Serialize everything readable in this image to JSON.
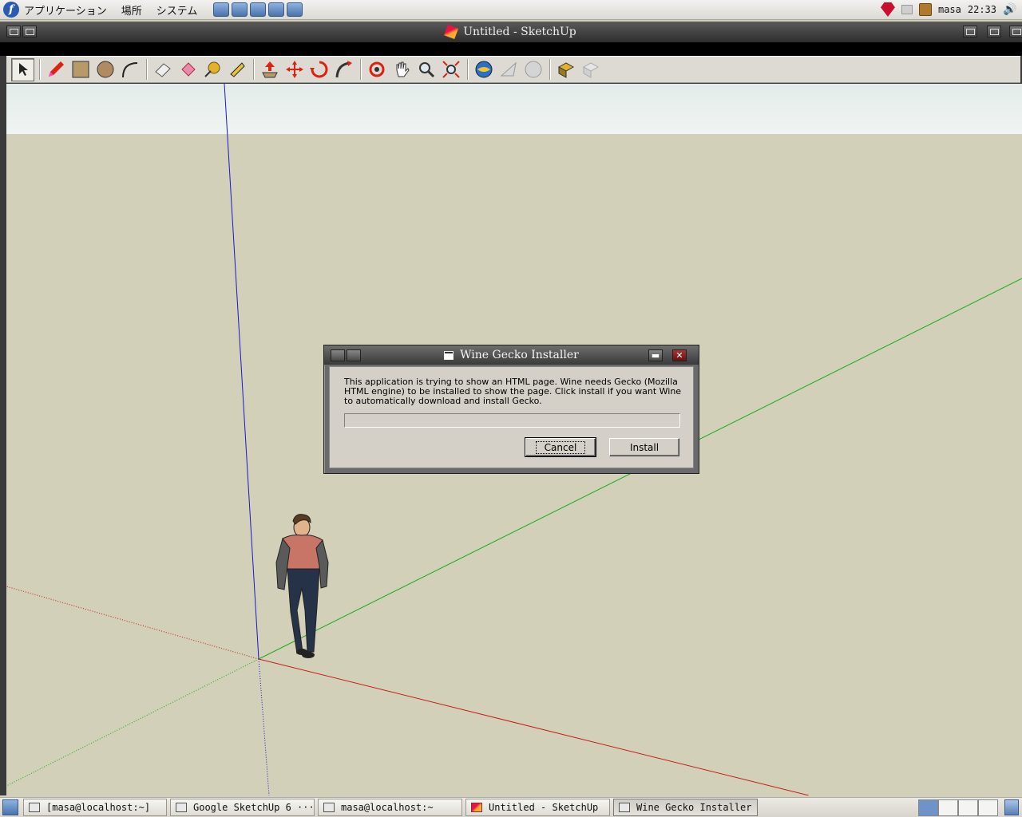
{
  "top_panel": {
    "menus": [
      "アプリケーション",
      "場所",
      "システム"
    ],
    "user": "masa",
    "clock": "22:33"
  },
  "window": {
    "title": "Untitled - SketchUp"
  },
  "toolbar": {
    "tools": [
      "select",
      "pencil",
      "rectangle",
      "circle",
      "arc",
      "eraser",
      "paint-bucket",
      "tape-measure",
      "dimension",
      "push-pull",
      "move",
      "rotate",
      "follow-me",
      "orbit",
      "pan",
      "zoom",
      "zoom-extents",
      "get-models",
      "share-model",
      "share-component",
      "components",
      "warehouse"
    ]
  },
  "dialog": {
    "title": "Wine Gecko Installer",
    "message": "This application is trying to show an HTML page. Wine needs Gecko (Mozilla HTML engine) to be installed to show the page. Click install if you want Wine to automatically download and install Gecko.",
    "cancel_label": "Cancel",
    "install_label": "Install",
    "progress": 0
  },
  "taskbar": {
    "tasks": [
      {
        "label": "[masa@localhost:~]",
        "active": false
      },
      {
        "label": "Google SketchUp 6 ···",
        "active": false
      },
      {
        "label": "masa@localhost:~",
        "active": false
      },
      {
        "label": "Untitled - SketchUp",
        "active": false
      },
      {
        "label": "Wine Gecko Installer",
        "active": true
      }
    ]
  },
  "colors": {
    "ground": "#d2d0b8",
    "axis_blue": "#1a1acc",
    "axis_green": "#1aaa1a",
    "axis_red": "#cc1a1a"
  }
}
